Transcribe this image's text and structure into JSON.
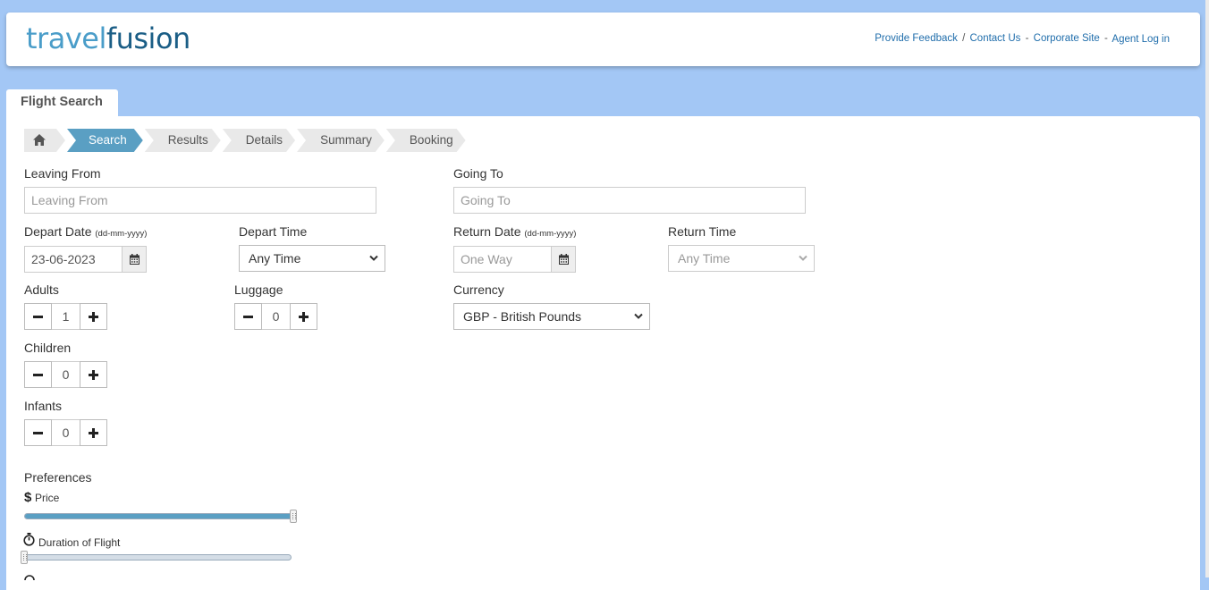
{
  "header": {
    "logo_part1": "travel",
    "logo_part2": "fusion",
    "links": {
      "feedback": "Provide Feedback",
      "slash": "/",
      "contact": "Contact Us",
      "dash1": "-",
      "corporate": "Corporate Site",
      "dash2": "-",
      "agent_login": "Agent Log in"
    }
  },
  "tab": {
    "label": "Flight Search"
  },
  "breadcrumb": {
    "home_icon": "home-icon",
    "steps": [
      "Search",
      "Results",
      "Details",
      "Summary",
      "Booking"
    ],
    "active": "Search"
  },
  "form": {
    "leaving_from": {
      "label": "Leaving From",
      "placeholder": "Leaving From"
    },
    "going_to": {
      "label": "Going To",
      "placeholder": "Going To"
    },
    "depart_date": {
      "label": "Depart Date",
      "hint": "(dd-mm-yyyy)",
      "value": "23-06-2023"
    },
    "depart_time": {
      "label": "Depart Time",
      "value": "Any Time"
    },
    "return_date": {
      "label": "Return Date",
      "hint": "(dd-mm-yyyy)",
      "placeholder": "One Way"
    },
    "return_time": {
      "label": "Return Time",
      "value": "Any Time"
    },
    "adults": {
      "label": "Adults",
      "value": "1"
    },
    "luggage": {
      "label": "Luggage",
      "value": "0"
    },
    "currency": {
      "label": "Currency",
      "value": "GBP - British Pounds"
    },
    "children": {
      "label": "Children",
      "value": "0"
    },
    "infants": {
      "label": "Infants",
      "value": "0"
    }
  },
  "preferences": {
    "title": "Preferences",
    "price": {
      "label": "Price",
      "level": 1.0
    },
    "duration": {
      "label": "Duration of Flight",
      "level": 0.0
    }
  },
  "colors": {
    "background": "#a3c7f5",
    "accent": "#5a9fc3",
    "link": "#1f6dab",
    "logo_light": "#4a9dc9",
    "logo_dark": "#1b5e86"
  }
}
